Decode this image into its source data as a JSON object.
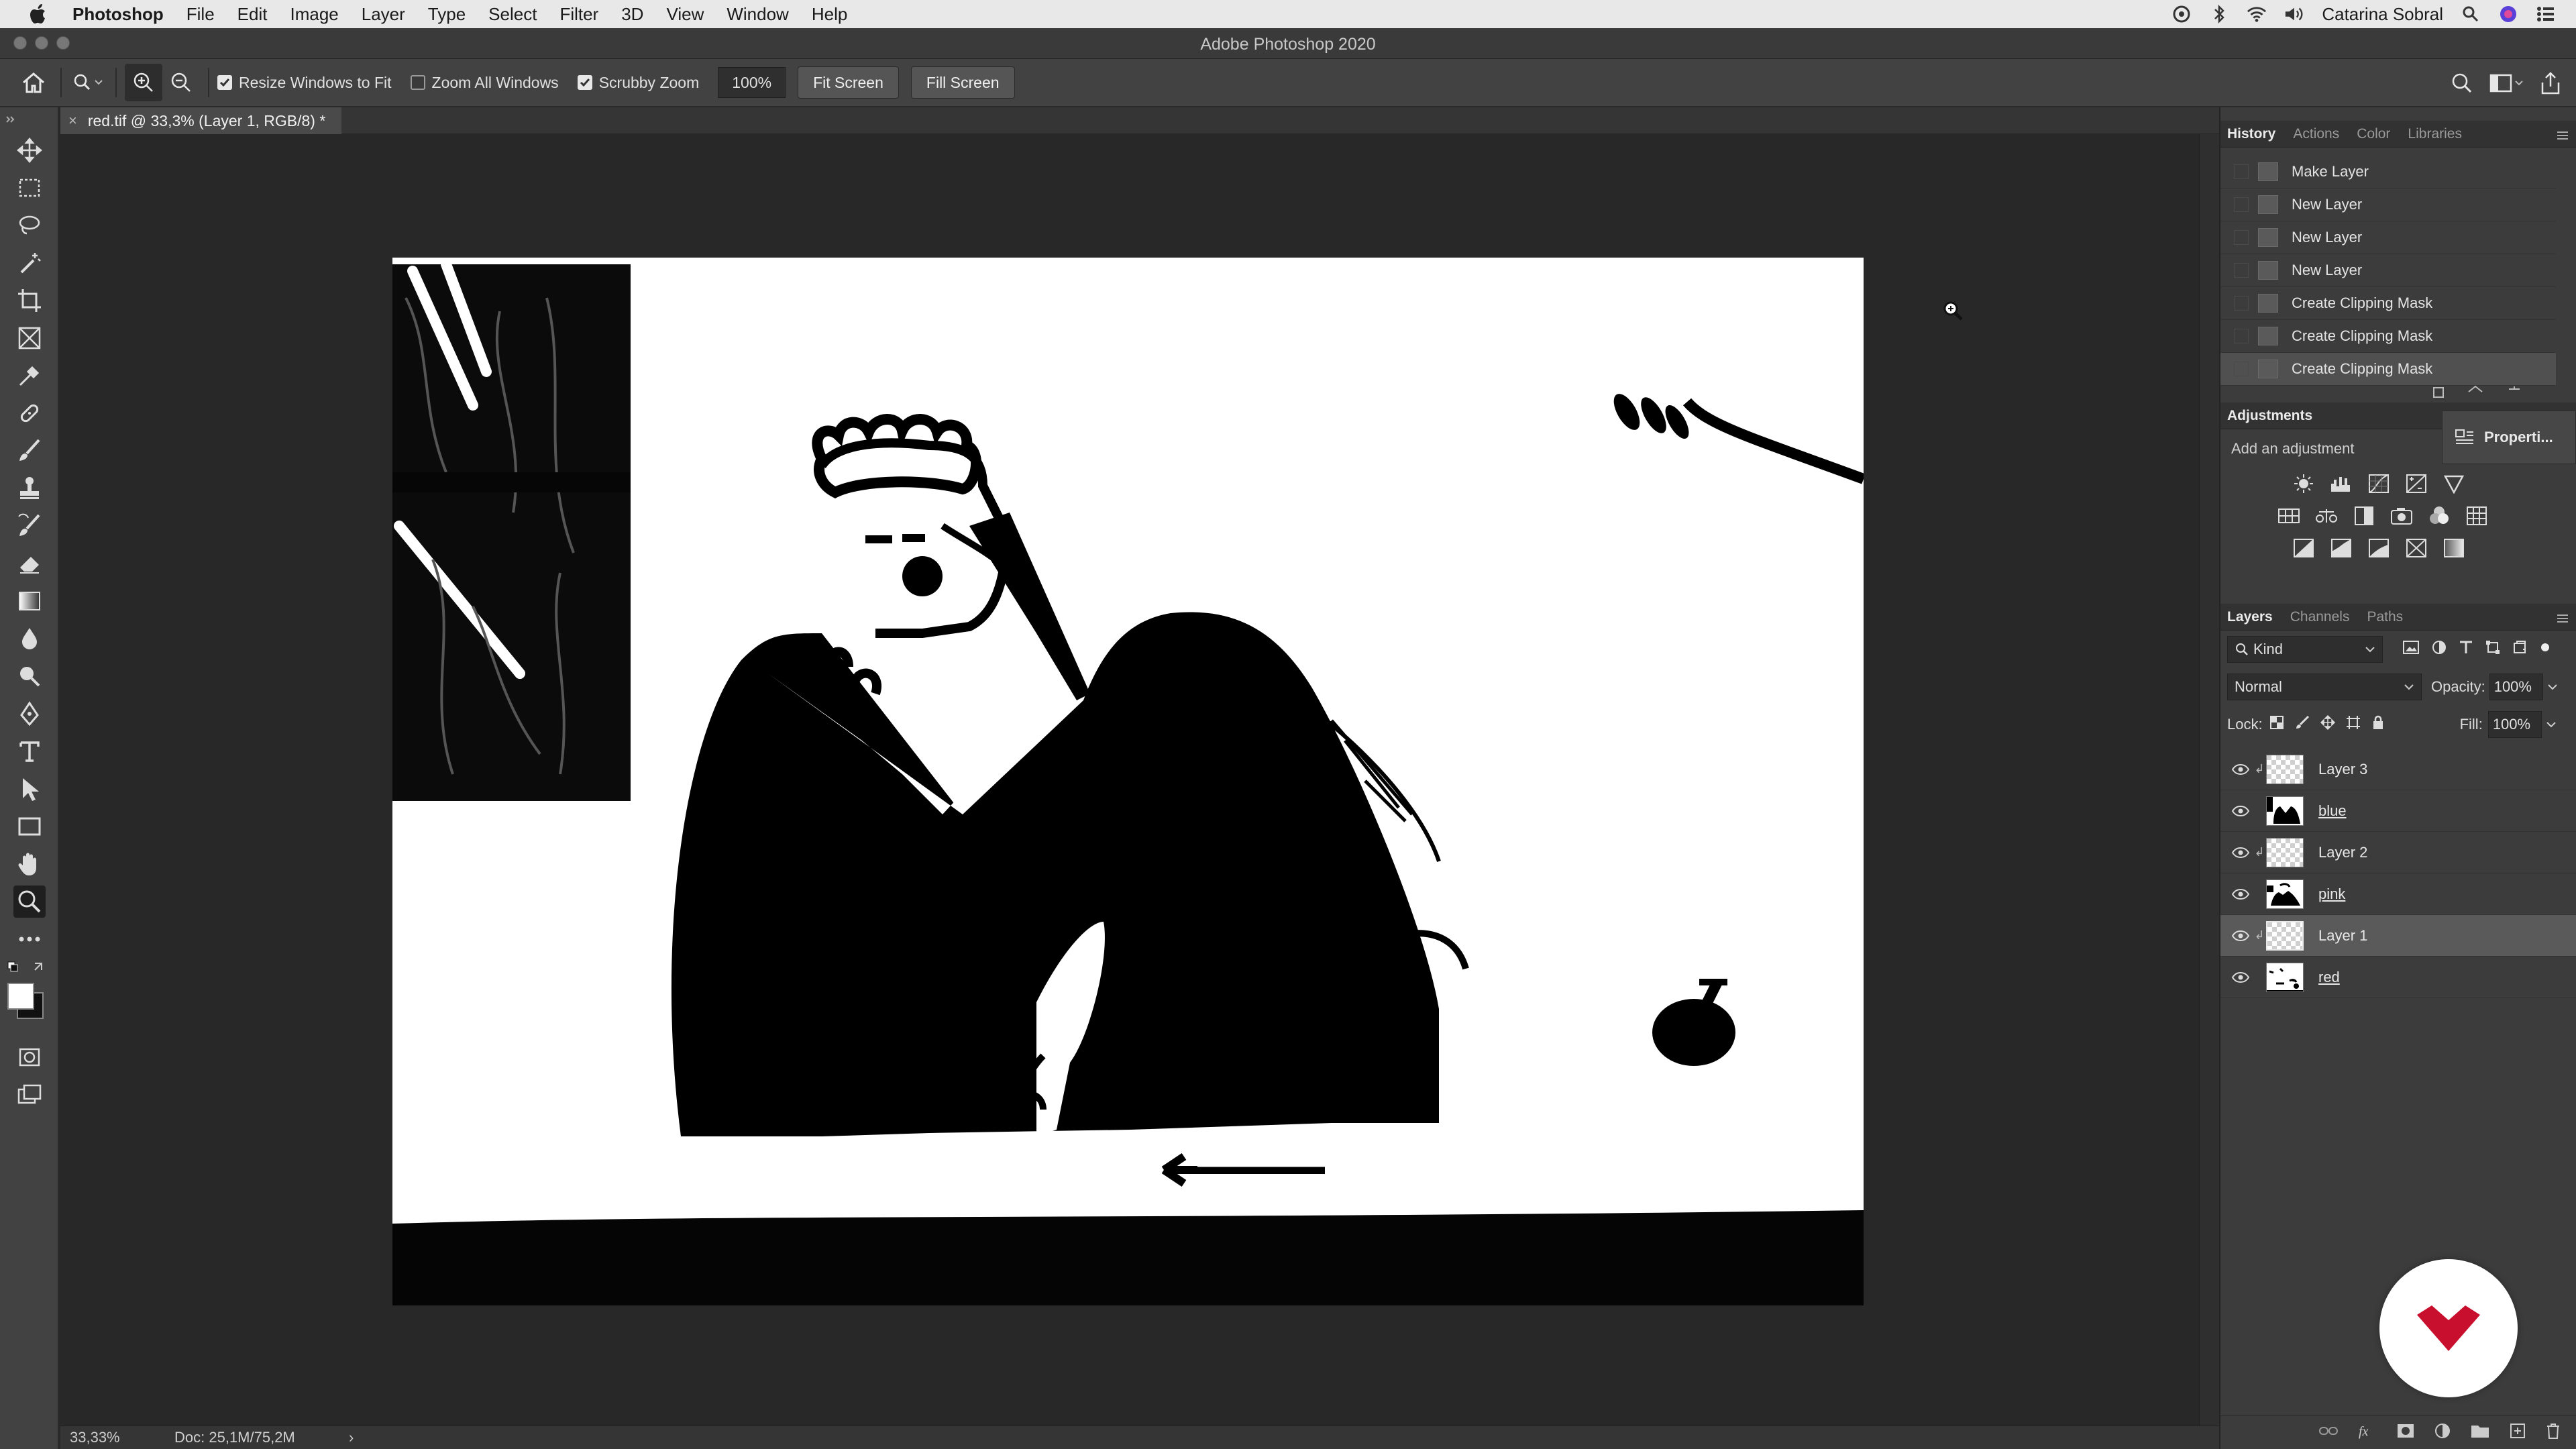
{
  "menubar": {
    "app_name": "Photoshop",
    "menus": [
      "File",
      "Edit",
      "Image",
      "Layer",
      "Type",
      "Select",
      "Filter",
      "3D",
      "View",
      "Window",
      "Help"
    ],
    "user": "Catarina Sobral"
  },
  "window": {
    "title": "Adobe Photoshop 2020"
  },
  "options": {
    "resize_windows": "Resize Windows to Fit",
    "zoom_all": "Zoom All Windows",
    "scrubby_zoom": "Scrubby Zoom",
    "zoom_value": "100%",
    "fit_screen": "Fit Screen",
    "fill_screen": "Fill Screen"
  },
  "document": {
    "tab_title": "red.tif @ 33,3% (Layer 1, RGB/8) *",
    "tab_close": "×"
  },
  "status": {
    "zoom": "33,33%",
    "doc": "Doc: 25,1M/75,2M",
    "arrow": "›"
  },
  "history_panel": {
    "tabs": [
      "History",
      "Actions",
      "Color",
      "Libraries"
    ],
    "items": [
      "Make Layer",
      "New Layer",
      "New Layer",
      "New Layer",
      "Create Clipping Mask",
      "Create Clipping Mask",
      "Create Clipping Mask"
    ]
  },
  "adjustments_panel": {
    "title": "Adjustments",
    "subtitle": "Add an adjustment",
    "properties_label": "Properti..."
  },
  "layers_panel": {
    "tabs": [
      "Layers",
      "Channels",
      "Paths"
    ],
    "kind": "Kind",
    "blend_mode": "Normal",
    "opacity_label": "Opacity:",
    "opacity_value": "100%",
    "lock_label": "Lock:",
    "fill_label": "Fill:",
    "fill_value": "100%",
    "layers": [
      {
        "name": "Layer 3",
        "clipped": true,
        "selected": false
      },
      {
        "name": "blue",
        "clipped": false,
        "selected": false
      },
      {
        "name": "Layer 2",
        "clipped": true,
        "selected": false
      },
      {
        "name": "pink",
        "clipped": false,
        "selected": false
      },
      {
        "name": "Layer 1",
        "clipped": true,
        "selected": true
      },
      {
        "name": "red",
        "clipped": false,
        "selected": false
      }
    ]
  },
  "colors": {
    "accent": "#c8102e",
    "canvas_bg": "#282828",
    "panel_bg": "#3c3c3c"
  }
}
